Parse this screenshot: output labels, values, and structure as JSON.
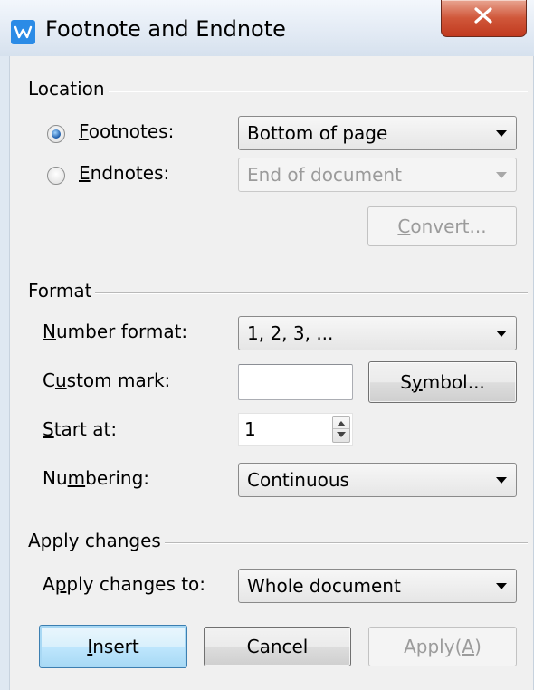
{
  "window": {
    "title": "Footnote and Endnote",
    "app_icon": "wps-writer-icon",
    "close_icon": "close-icon"
  },
  "location": {
    "group_label": "Location",
    "footnotes": {
      "label": "Footnotes:",
      "mnemonic": "F",
      "selected": true,
      "value": "Bottom of page"
    },
    "endnotes": {
      "label": "Endnotes:",
      "mnemonic": "E",
      "selected": false,
      "value": "End of document"
    },
    "convert_button": {
      "label": "Convert...",
      "mnemonic": "C",
      "enabled": false
    }
  },
  "format": {
    "group_label": "Format",
    "number_format": {
      "label": "Number format:",
      "mnemonic": "N",
      "value": "1, 2, 3, ..."
    },
    "custom_mark": {
      "label": "Custom mark:",
      "mnemonic": "u",
      "value": ""
    },
    "symbol_button": {
      "label": "Symbol...",
      "mnemonic": "y"
    },
    "start_at": {
      "label": "Start at:",
      "mnemonic": "S",
      "value": "1"
    },
    "numbering": {
      "label": "Numbering:",
      "mnemonic": "m",
      "value": "Continuous"
    }
  },
  "apply": {
    "group_label": "Apply changes",
    "apply_to": {
      "label": "Apply changes to:",
      "mnemonic": "p",
      "value": "Whole document"
    }
  },
  "buttons": {
    "insert": {
      "label": "Insert",
      "mnemonic": "I"
    },
    "cancel": {
      "label": "Cancel"
    },
    "apply": {
      "label": "Apply(A)",
      "mnemonic": "A",
      "enabled": false
    }
  }
}
